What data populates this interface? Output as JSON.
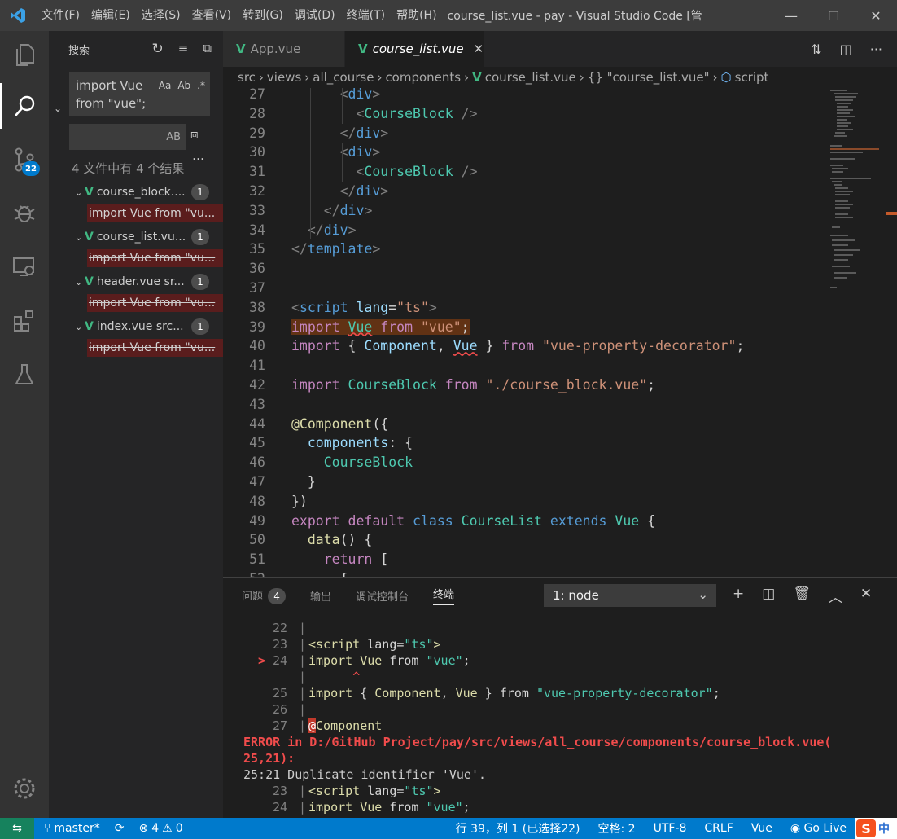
{
  "window": {
    "title": "course_list.vue - pay - Visual Studio Code [管...",
    "menu": [
      "文件(F)",
      "编辑(E)",
      "选择(S)",
      "查看(V)",
      "转到(G)",
      "调试(D)",
      "终端(T)",
      "帮助(H)"
    ]
  },
  "activity_bar": {
    "scm_badge": "22"
  },
  "sidebar": {
    "title": "搜索",
    "search_value_line1": "import Vue",
    "search_value_line2": "from \"vue\";",
    "replace_opt": "AB",
    "result_summary": "4 文件中有 4 个结果",
    "results": [
      {
        "file": "course_block....",
        "count": "1",
        "match": "import Vue from \"vu..."
      },
      {
        "file": "course_list.vu...",
        "count": "1",
        "match": "import Vue from \"vu..."
      },
      {
        "file": "header.vue sr...",
        "count": "1",
        "match": "import Vue from \"vu..."
      },
      {
        "file": "index.vue src...",
        "count": "1",
        "match": "import Vue from \"vu..."
      }
    ]
  },
  "tabs": [
    {
      "label": "App.vue",
      "active": false
    },
    {
      "label": "course_list.vue",
      "active": true
    }
  ],
  "breadcrumb": [
    "src",
    "views",
    "all_course",
    "components",
    "course_list.vue",
    "{} \"course_list.vue\"",
    "script"
  ],
  "editor": {
    "lines": [
      {
        "n": "27",
        "html": "      <span class='t'>&lt;</span><span class='tg'>div</span><span class='t'>&gt;</span>"
      },
      {
        "n": "28",
        "html": "        <span class='t'>&lt;</span><span class='cp'>CourseBlock</span> <span class='t'>/&gt;</span>"
      },
      {
        "n": "29",
        "html": "      <span class='t'>&lt;/</span><span class='tg'>div</span><span class='t'>&gt;</span>"
      },
      {
        "n": "30",
        "html": "      <span class='t'>&lt;</span><span class='tg'>div</span><span class='t'>&gt;</span>"
      },
      {
        "n": "31",
        "html": "        <span class='t'>&lt;</span><span class='cp'>CourseBlock</span> <span class='t'>/&gt;</span>"
      },
      {
        "n": "32",
        "html": "      <span class='t'>&lt;/</span><span class='tg'>div</span><span class='t'>&gt;</span>"
      },
      {
        "n": "33",
        "html": "    <span class='t'>&lt;/</span><span class='tg'>div</span><span class='t'>&gt;</span>"
      },
      {
        "n": "34",
        "html": "  <span class='t'>&lt;/</span><span class='tg'>div</span><span class='t'>&gt;</span>"
      },
      {
        "n": "35",
        "html": "<span class='t'>&lt;/</span><span class='tg'>template</span><span class='t'>&gt;</span>"
      },
      {
        "n": "36",
        "html": ""
      },
      {
        "n": "37",
        "html": ""
      },
      {
        "n": "38",
        "html": "<span class='t'>&lt;</span><span class='tg'>script</span> <span class='at'>lang</span><span class='pl'>=</span><span class='st'>\"ts\"</span><span class='t'>&gt;</span>"
      },
      {
        "n": "39",
        "html": "<span class='hl'><span class='kw'>import</span> <span class='cp squig'>Vue</span> <span class='kw'>from</span> <span class='st'>\"vue\"</span><span class='pl'>;</span></span>"
      },
      {
        "n": "40",
        "html": "<span class='kw'>import</span> <span class='pl'>{</span> <span class='at'>Component</span><span class='pl'>,</span> <span class='at squig'>Vue</span> <span class='pl'>}</span> <span class='kw'>from</span> <span class='st'>\"vue-property-decorator\"</span><span class='pl'>;</span>"
      },
      {
        "n": "41",
        "html": ""
      },
      {
        "n": "42",
        "html": "<span class='kw'>import</span> <span class='cp'>CourseBlock</span> <span class='kw'>from</span> <span class='st'>\"./course_block.vue\"</span><span class='pl'>;</span>"
      },
      {
        "n": "43",
        "html": ""
      },
      {
        "n": "44",
        "html": "<span class='fn'>@Component</span><span class='pl'>({</span>"
      },
      {
        "n": "45",
        "html": "  <span class='at'>components</span><span class='pl'>: {</span>"
      },
      {
        "n": "46",
        "html": "    <span class='cp'>CourseBlock</span>"
      },
      {
        "n": "47",
        "html": "  <span class='pl'>}</span>"
      },
      {
        "n": "48",
        "html": "<span class='pl'>})</span>"
      },
      {
        "n": "49",
        "html": "<span class='kw'>export</span> <span class='kw'>default</span> <span class='bl'>class</span> <span class='cp'>CourseList</span> <span class='bl'>extends</span> <span class='cp'>Vue</span> <span class='pl'>{</span>"
      },
      {
        "n": "50",
        "html": "  <span class='fn'>data</span><span class='pl'>() {</span>"
      },
      {
        "n": "51",
        "html": "    <span class='kw'>return</span> <span class='pl'>[</span>"
      },
      {
        "n": "52",
        "html": "      <span class='pl'>{</span>"
      }
    ]
  },
  "panel": {
    "tabs": [
      {
        "label": "问题",
        "badge": "4"
      },
      {
        "label": "输出"
      },
      {
        "label": "调试控制台"
      },
      {
        "label": "终端",
        "active": true
      }
    ],
    "terminal_select": "1: node",
    "terminal": [
      {
        "num": "22",
        "code": ""
      },
      {
        "num": "23",
        "code": "<span class='fn'>&lt;script</span> <span class='pl'>lang=</span><span class='cp'>\"ts\"</span><span class='fn'>&gt;</span>"
      },
      {
        "num": "24",
        "marker": ">",
        "code": "<span class='fn'>import</span> <span class='fn'>Vue</span> <span class='pl'>from</span> <span class='cp'>\"vue\"</span><span class='pl'>;</span>"
      },
      {
        "num": "",
        "code": "      <span style='color:#f14c4c'>^</span>"
      },
      {
        "num": "25",
        "code": "<span class='fn'>import</span> <span class='pl'>{</span> <span class='fn'>Component</span><span class='pl'>,</span> <span class='fn'>Vue</span> <span class='pl'>}</span> <span class='pl'>from</span> <span class='cp'>\"vue-property-decorator\"</span><span class='pl'>;</span>"
      },
      {
        "num": "26",
        "code": ""
      },
      {
        "num": "27",
        "code": "<span style='background:#c0392b;color:#fff'>@</span><span class='fn'>Component</span>"
      }
    ],
    "error_line1": "ERROR in D:/GitHub Project/pay/src/views/all_course/components/course_block.vue(",
    "error_line2": "25,21):",
    "error_msg": "25:21 Duplicate identifier 'Vue'.",
    "terminal_tail": [
      {
        "num": "23",
        "code": "<span class='fn'>&lt;script</span> <span class='pl'>lang=</span><span class='cp'>\"ts\"</span><span class='fn'>&gt;</span>"
      },
      {
        "num": "24",
        "code": "<span class='fn'>import</span> <span class='fn'>Vue</span> <span class='pl'>from</span> <span class='cp'>\"vue\"</span><span class='pl'>;</span>"
      }
    ]
  },
  "status_bar": {
    "branch": "master*",
    "errors": "4",
    "warnings": "0",
    "position": "行 39，列 1 (已选择22)",
    "spaces": "空格: 2",
    "encoding": "UTF-8",
    "eol": "CRLF",
    "language": "Vue",
    "golive": "Go Live",
    "ime": "中"
  },
  "colors": {
    "accent": "#007acc",
    "vue": "#41b883",
    "error": "#f14c4c"
  }
}
